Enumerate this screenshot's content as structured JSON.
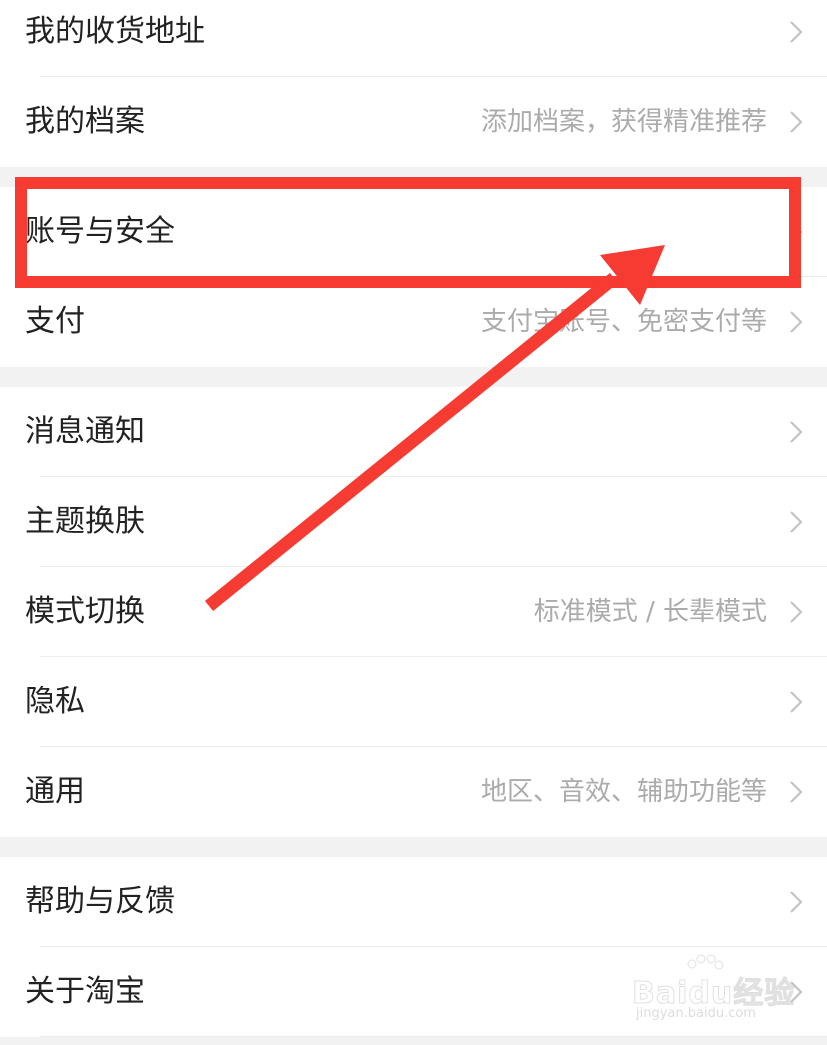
{
  "groups": [
    {
      "items": [
        {
          "label": "我的收货地址",
          "hint": ""
        },
        {
          "label": "我的档案",
          "hint": "添加档案，获得精准推荐"
        }
      ]
    },
    {
      "items": [
        {
          "label": "账号与安全",
          "hint": ""
        },
        {
          "label": "支付",
          "hint": "支付宝账号、免密支付等"
        }
      ]
    },
    {
      "items": [
        {
          "label": "消息通知",
          "hint": ""
        },
        {
          "label": "主题换肤",
          "hint": ""
        },
        {
          "label": "模式切换",
          "hint": "标准模式 / 长辈模式"
        },
        {
          "label": "隐私",
          "hint": ""
        },
        {
          "label": "通用",
          "hint": "地区、音效、辅助功能等"
        }
      ]
    },
    {
      "items": [
        {
          "label": "帮助与反馈",
          "hint": ""
        },
        {
          "label": "关于淘宝",
          "hint": ""
        }
      ]
    }
  ],
  "annotation": {
    "highlight_color": "#f53b32",
    "highlighted_item": "账号与安全"
  },
  "watermark": {
    "brand": "Baidu经验",
    "url": "jingyan.baidu.com"
  },
  "icons": {
    "row_arrow": "chevron-right-icon"
  }
}
